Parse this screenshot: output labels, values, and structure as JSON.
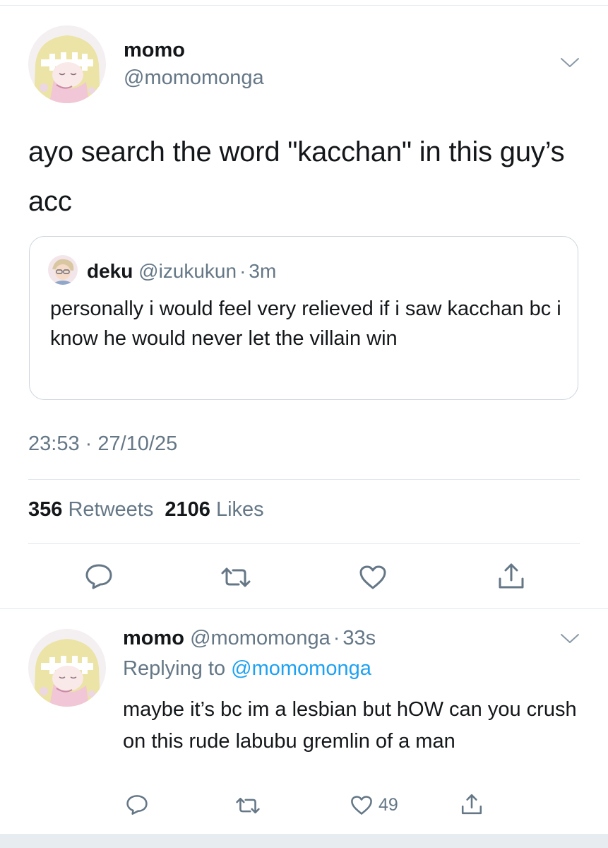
{
  "main_tweet": {
    "author_name": "momo",
    "author_handle": "@momomonga",
    "text": "ayo search the word \"kacchan\" in this guy’s acc",
    "quote": {
      "name": "deku",
      "handle": "@izukukun",
      "separator": "·",
      "time": "3m",
      "text": "personally i would feel very relieved if i saw kacchan bc i know he would never let the villain win"
    },
    "timestamp": "23:53 · 27/10/25",
    "retweets_count": "356",
    "retweets_label": "Retweets",
    "likes_count": "2106",
    "likes_label": "Likes"
  },
  "reply_tweet": {
    "author_name": "momo",
    "author_handle": "@momomonga",
    "separator": "·",
    "time": "33s",
    "replying_label": "Replying to",
    "replying_handle": "@momomonga",
    "text": "maybe it’s bc im a lesbian but hOW can you crush on this rude labubu gremlin of a man",
    "likes_count": "49"
  },
  "icons": [
    "chevron-down-icon",
    "reply-icon",
    "retweet-icon",
    "like-icon",
    "share-icon"
  ],
  "colors": {
    "text": "#14171a",
    "muted": "#657786",
    "link": "#1da1f2",
    "divider": "#e1e8ed",
    "icon": "#657786"
  }
}
